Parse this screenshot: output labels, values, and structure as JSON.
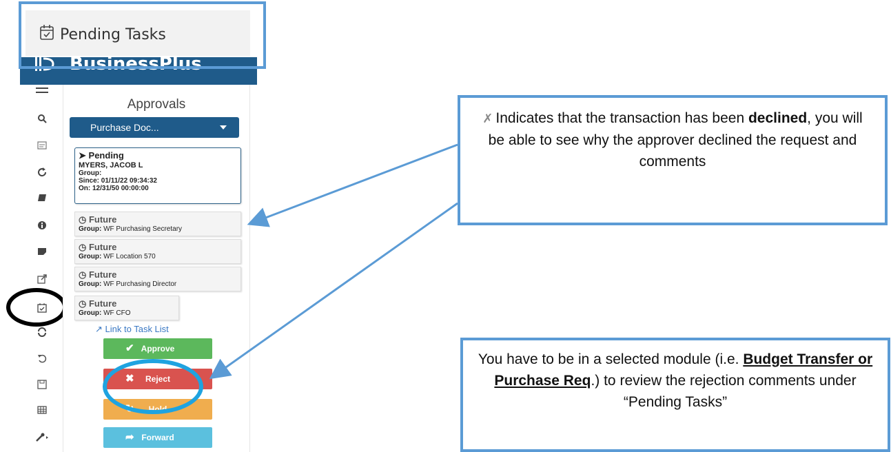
{
  "header_callout": {
    "title": "Pending Tasks",
    "icon": "calendar-check-icon"
  },
  "app": {
    "brand": "BusinessPlus"
  },
  "rail": {
    "icons": [
      "menu-icon",
      "search-icon",
      "id-card-icon",
      "refresh-icon",
      "book-icon",
      "info-icon",
      "note-icon",
      "external-link-icon",
      "calendar-check-icon",
      "sync-icon",
      "undo-icon",
      "save-icon",
      "table-icon",
      "wrench-icon"
    ]
  },
  "approvals": {
    "title": "Approvals",
    "doc_select": "Purchase Doc...",
    "tasks": [
      {
        "status": "Pending",
        "name": "MYERS, JACOB L",
        "group_label": "Group:",
        "since": "Since: 01/11/22 09:34:32",
        "on": "On: 12/31/50 00:00:00"
      },
      {
        "status": "Future",
        "group_label": "Group:",
        "group": "WF Purchasing Secretary"
      },
      {
        "status": "Future",
        "group_label": "Group:",
        "group": "WF Location 570"
      },
      {
        "status": "Future",
        "group_label": "Group:",
        "group": "WF Purchasing Director"
      },
      {
        "status": "Future",
        "group_label": "Group:",
        "group": "WF CFO"
      }
    ],
    "link_task_list": "Link to Task List",
    "buttons": {
      "approve": "Approve",
      "reject": "Reject",
      "hold": "Hold",
      "forward": "Forward"
    }
  },
  "callouts": {
    "declined": {
      "pre": "Indicates that the transaction has been",
      "bold": "declined",
      "post": ", you will be able to see why the approver declined the request and comments"
    },
    "module": {
      "pre": "You have to be in a selected module (i.e.",
      "bold_link": "Budget Transfer or Purchase Req",
      "post": ".) to review the rejection comments under “Pending Tasks”"
    }
  },
  "colors": {
    "appbar": "#1f5b8a",
    "callout_border": "#5b9bd5",
    "approve": "#5cb85c",
    "reject": "#d9534f",
    "hold": "#f0ad4e",
    "forward": "#5bc0de",
    "highlight_oval": "#1fa3e0"
  }
}
